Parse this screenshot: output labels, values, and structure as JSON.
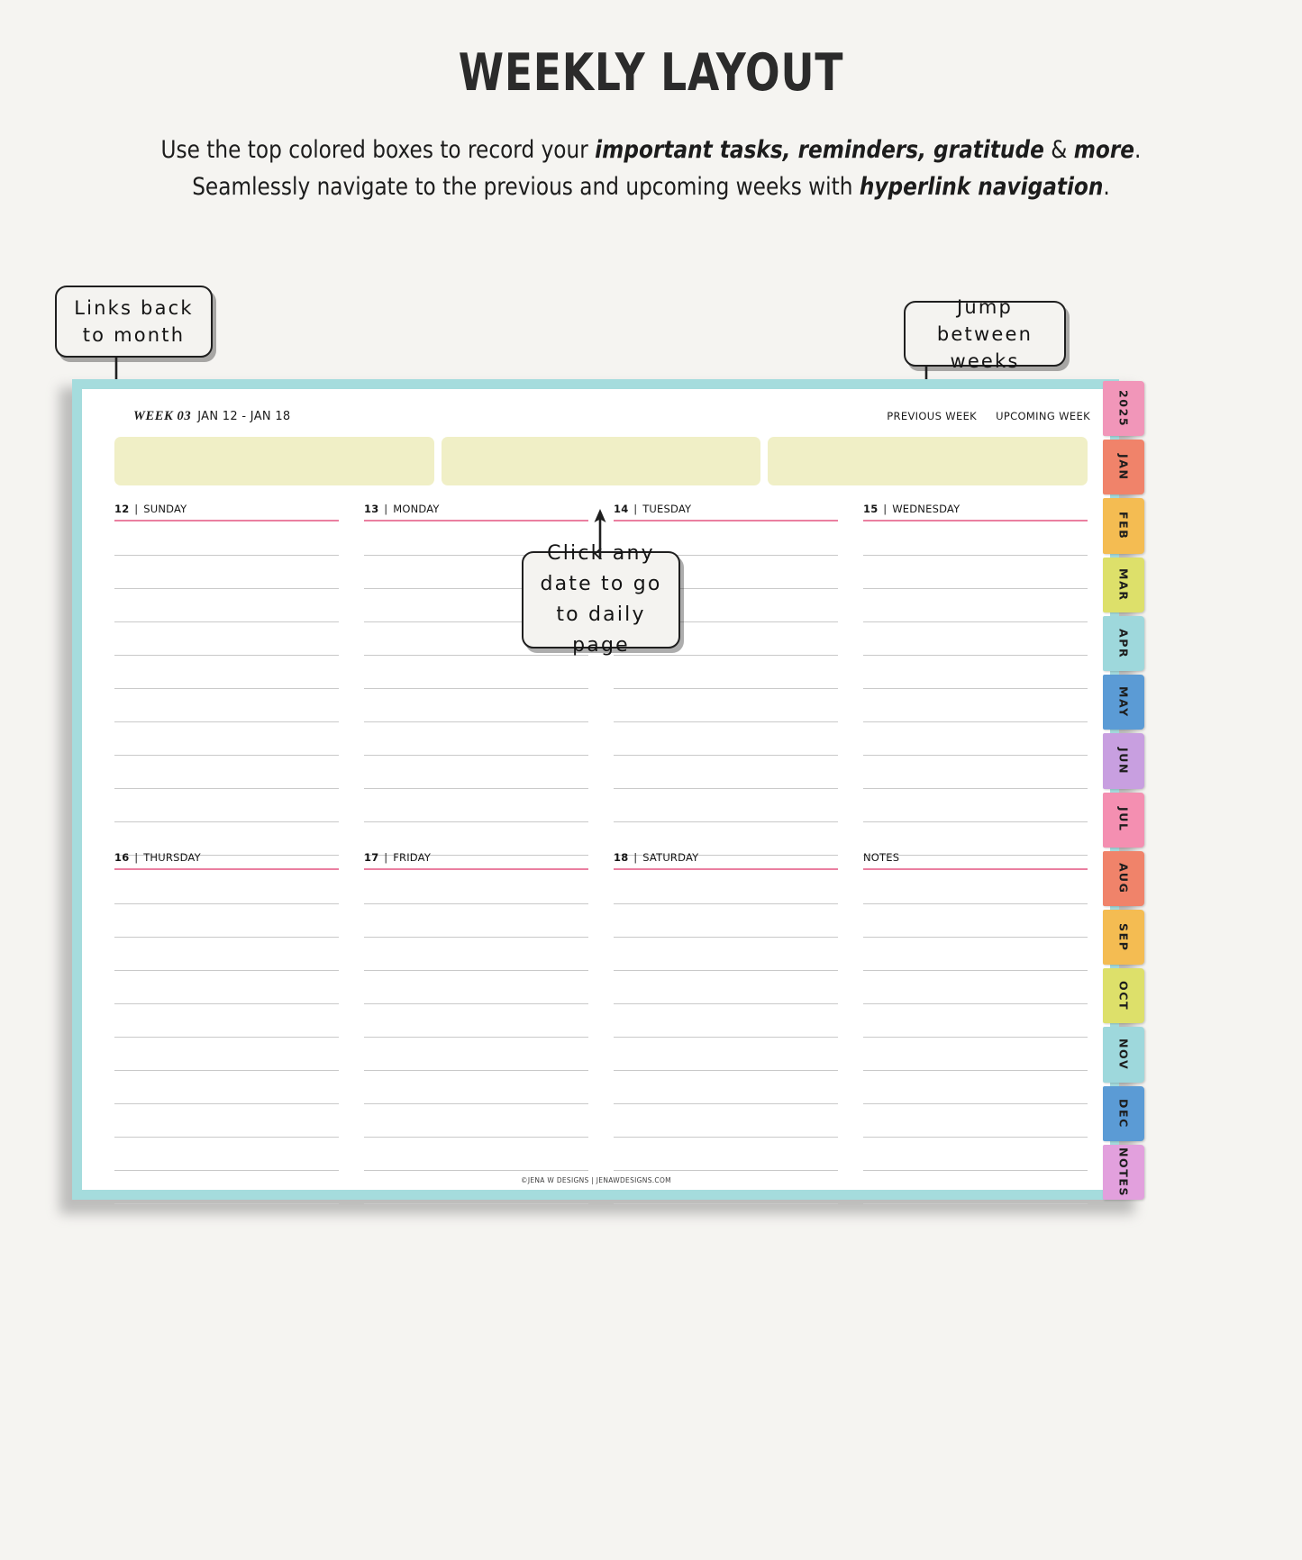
{
  "header": {
    "title": "WEEKLY LAYOUT",
    "subtitle_line1_pre": "Use the top colored boxes to record your ",
    "subtitle_line1_bold": "important tasks, reminders, gratitude",
    "subtitle_line1_mid": " & ",
    "subtitle_line1_bold2": "more",
    "subtitle_line1_post": ".",
    "subtitle_line2_pre": "Seamlessly navigate to the  previous and upcoming weeks with ",
    "subtitle_line2_bold": "hyperlink navigation",
    "subtitle_line2_post": "."
  },
  "callouts": {
    "month": "Links back to month",
    "weeks": "Jump between weeks",
    "date": "Click any date to go to daily page"
  },
  "planner": {
    "week_number": "WEEK 03",
    "week_range": "JAN 12 - JAN 18",
    "nav": {
      "previous": "PREVIOUS WEEK",
      "upcoming": "UPCOMING WEEK"
    },
    "top_boxes": [
      "",
      "",
      ""
    ],
    "days_row1": [
      {
        "num": "12",
        "name": "SUNDAY",
        "lines": 10
      },
      {
        "num": "13",
        "name": "MONDAY",
        "lines": 10
      },
      {
        "num": "14",
        "name": "TUESDAY",
        "lines": 10
      },
      {
        "num": "15",
        "name": "WEDNESDAY",
        "lines": 10
      }
    ],
    "days_row2": [
      {
        "num": "16",
        "name": "THURSDAY",
        "lines": 10
      },
      {
        "num": "17",
        "name": "FRIDAY",
        "lines": 10
      },
      {
        "num": "18",
        "name": "SATURDAY",
        "lines": 10
      },
      {
        "num": "",
        "name": "NOTES",
        "lines": 10
      }
    ],
    "footer": "©JENA W DESIGNS | JENAWDESIGNS.COM",
    "border_color": "#a5dcdd"
  },
  "tabs": [
    {
      "label": "2025",
      "color": "#f196b9"
    },
    {
      "label": "JAN",
      "color": "#f0836a"
    },
    {
      "label": "FEB",
      "color": "#f4b council"
    },
    {
      "label": "MAR",
      "color": "#dde06a"
    },
    {
      "label": "APR",
      "color": "#9ed8dc"
    },
    {
      "label": "MAY",
      "color": "#5b9bd5"
    },
    {
      "label": "JUN",
      "color": "#c89fe0"
    },
    {
      "label": "JUL",
      "color": "#f48fb1"
    },
    {
      "label": "AUG",
      "color": "#f0836a"
    },
    {
      "label": "SEP",
      "color": "#f4b champ"
    },
    {
      "label": "OCT",
      "color": "#dde06a"
    },
    {
      "label": "NOV",
      "color": "#9ed8dc"
    },
    {
      "label": "DEC",
      "color": "#5b9bd5"
    },
    {
      "label": "NOTES",
      "color": "#e2a0dd"
    }
  ],
  "tab_colors_fixed": [
    "#f196b9",
    "#f0836a",
    "#f4bc52",
    "#dde06a",
    "#9ed8dc",
    "#5b9bd5",
    "#c89fe0",
    "#f48fb1",
    "#f0836a",
    "#f4bc52",
    "#dde06a",
    "#9ed8dc",
    "#5b9bd5",
    "#e2a0dd"
  ]
}
